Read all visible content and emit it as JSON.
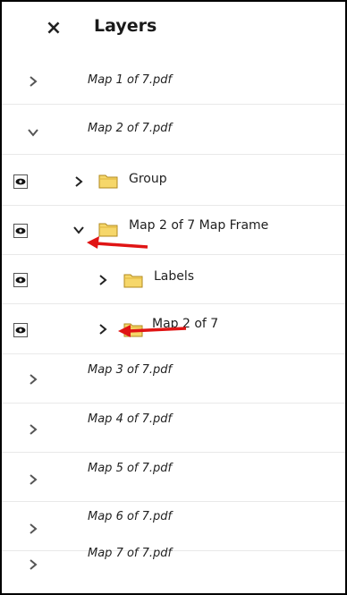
{
  "header": {
    "close_glyph": "×",
    "title": "Layers"
  },
  "documents_top": [
    {
      "label": "Map 1 of 7.pdf",
      "expanded": false
    },
    {
      "label": "Map 2 of 7.pdf",
      "expanded": true
    }
  ],
  "layers": [
    {
      "label": "Group",
      "expanded": false,
      "visible": true,
      "icon": "folder-icon"
    },
    {
      "label": "Map 2 of 7 Map Frame",
      "expanded": true,
      "visible": true,
      "icon": "folder-icon"
    },
    {
      "label": "Labels",
      "expanded": false,
      "visible": true,
      "icon": "folder-icon"
    },
    {
      "label": "Map 2 of 7",
      "expanded": false,
      "visible": true,
      "icon": "folder-icon"
    }
  ],
  "documents_bottom": [
    {
      "label": "Map 3 of 7.pdf",
      "expanded": false
    },
    {
      "label": "Map 4 of 7.pdf",
      "expanded": false
    },
    {
      "label": "Map 5 of 7.pdf",
      "expanded": false
    },
    {
      "label": "Map 6 of 7.pdf",
      "expanded": false
    },
    {
      "label": "Map 7 of 7.pdf",
      "expanded": false
    }
  ],
  "colors": {
    "annotation_arrow": "#e01414",
    "folder_fill": "#f6d76a",
    "folder_stroke": "#b08a1e",
    "chevron": "#555555"
  },
  "icons": {
    "close": "close-icon",
    "chevron_collapsed": "chevron-right-icon",
    "chevron_expanded": "chevron-down-icon",
    "visibility": "eye-icon",
    "annotation": "red-arrow-icon"
  }
}
